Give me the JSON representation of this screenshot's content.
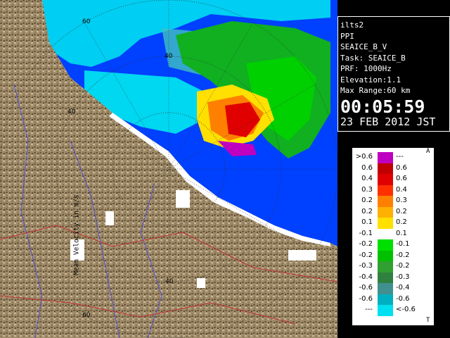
{
  "info": {
    "station": "ilts2",
    "scan_type": "PPI",
    "product": "SEAICE_B_V",
    "task": "Task: SEAICE_B",
    "prf": "PRF: 1000Hz",
    "elevation": "Elevation:1.1",
    "max_range": "Max Range:60 km",
    "time": "00:05:59",
    "date": "23 FEB 2012 JST"
  },
  "range_labels": {
    "top": "60",
    "upper": "40",
    "left": "40",
    "bottom_inner": "40",
    "bottom_outer": "60"
  },
  "legend": {
    "title": "Mean Velocity in m/s",
    "top_marker": "A",
    "bottom_marker": "T",
    "rows": [
      {
        "left": ">0.6",
        "right": "---",
        "color": "#c000c0"
      },
      {
        "left": "0.6",
        "right": "0.6",
        "color": "#c00000"
      },
      {
        "left": "0.4",
        "right": "0.6",
        "color": "#e00000"
      },
      {
        "left": "0.3",
        "right": "0.4",
        "color": "#ff3000"
      },
      {
        "left": "0.2",
        "right": "0.3",
        "color": "#ff8000"
      },
      {
        "left": "0.2",
        "right": "0.2",
        "color": "#ffb000"
      },
      {
        "left": "0.1",
        "right": "0.2",
        "color": "#ffe000"
      },
      {
        "left": "-0.1",
        "right": "0.1",
        "color": "#ffffff"
      },
      {
        "left": "-0.2",
        "right": "-0.1",
        "color": "#00e000"
      },
      {
        "left": "-0.2",
        "right": "-0.2",
        "color": "#00c000"
      },
      {
        "left": "-0.3",
        "right": "-0.2",
        "color": "#30a030"
      },
      {
        "left": "-0.4",
        "right": "-0.3",
        "color": "#308040"
      },
      {
        "left": "-0.6",
        "right": "-0.4",
        "color": "#409090"
      },
      {
        "left": "-0.6",
        "right": "-0.6",
        "color": "#00b0c0"
      },
      {
        "left": "---",
        "right": "<-0.6",
        "color": "#00e0f0"
      }
    ]
  },
  "colors": {
    "sea": "#0040ff",
    "land": "#a08c6a",
    "no_echo": "#ffffff",
    "ring": "#303030"
  }
}
